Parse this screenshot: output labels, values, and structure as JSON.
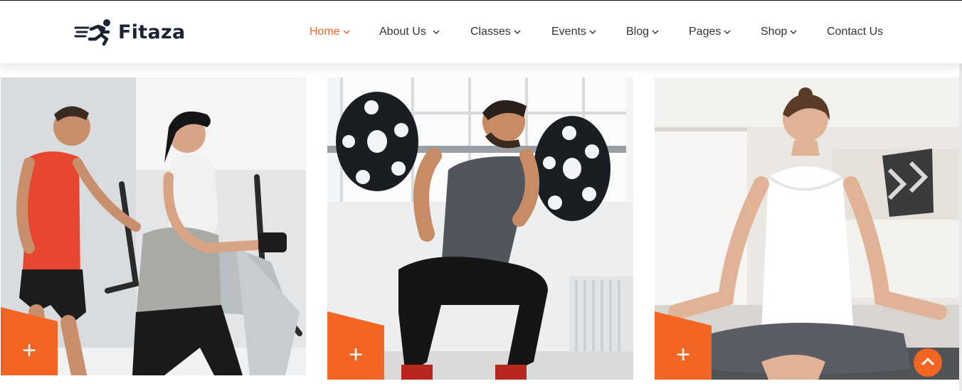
{
  "brand": {
    "name": "Fitaza",
    "logo_icon": "running-man-icon"
  },
  "nav": {
    "items": [
      {
        "label": "Home",
        "active": true,
        "has_dropdown": true
      },
      {
        "label": "About Us",
        "active": false,
        "has_dropdown": true
      },
      {
        "label": "Classes",
        "active": false,
        "has_dropdown": true
      },
      {
        "label": "Events",
        "active": false,
        "has_dropdown": true
      },
      {
        "label": "Blog",
        "active": false,
        "has_dropdown": true
      },
      {
        "label": "Pages",
        "active": false,
        "has_dropdown": true
      },
      {
        "label": "Shop",
        "active": false,
        "has_dropdown": true
      },
      {
        "label": "Contact Us",
        "active": false,
        "has_dropdown": false
      }
    ]
  },
  "cards": [
    {
      "image": "cardio-treadmill-couple-photo",
      "action_symbol": "+"
    },
    {
      "image": "barbell-squat-man-photo",
      "action_symbol": "+"
    },
    {
      "image": "yoga-meditation-woman-photo",
      "action_symbol": "+"
    }
  ],
  "scroll_top": {
    "icon": "chevron-up-icon"
  },
  "colors": {
    "accent": "#f26522",
    "dark": "#1e2235",
    "text": "#333333"
  }
}
